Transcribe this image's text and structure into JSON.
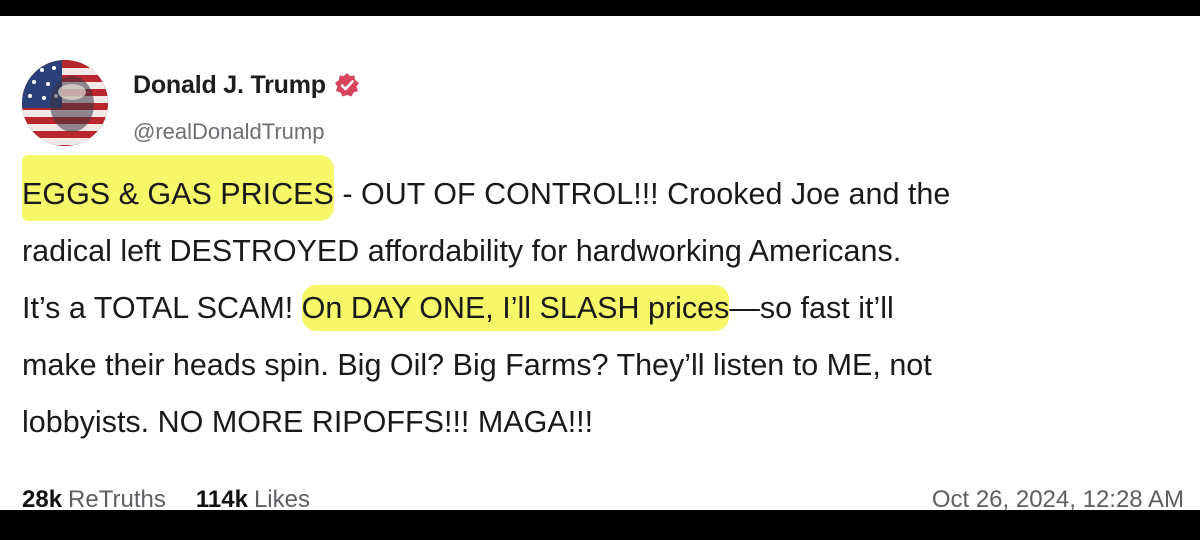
{
  "post": {
    "author_name": "Donald J. Trump",
    "handle": "@realDonaldTrump",
    "verified_icon": "verified-badge-icon",
    "avatar_icon": "flag-portrait-avatar",
    "body_lines": [
      {
        "seg1_hl": "EGGS & GAS PRICES",
        "seg2": " - OUT OF CONTROL!!! Crooked Joe and the"
      },
      {
        "seg1": "radical left DESTRO",
        "seg2_hl": "YED affordability for hardworking",
        "seg3": " Americans."
      },
      {
        "seg1": "It’s a TOTAL SCAM! ",
        "seg2_hl": "On DAY ONE, I’ll SLASH prices",
        "seg3": "—so fast it’ll"
      },
      {
        "text": "make their heads spin. Big Oil? Big Farms? They’ll listen to ME, not"
      },
      {
        "text": "lobbyists. NO MORE RIPOFFS!!! MAGA!!!"
      }
    ],
    "retruths_count": "28k",
    "retruths_label": "ReTruths",
    "likes_count": "114k",
    "likes_label": "Likes",
    "timestamp": "Oct 26, 2024, 12:28 AM"
  },
  "colors": {
    "highlight": "#f7f76a",
    "verified": "#d9435e",
    "background": "#ffffff",
    "frame": "#000000"
  }
}
